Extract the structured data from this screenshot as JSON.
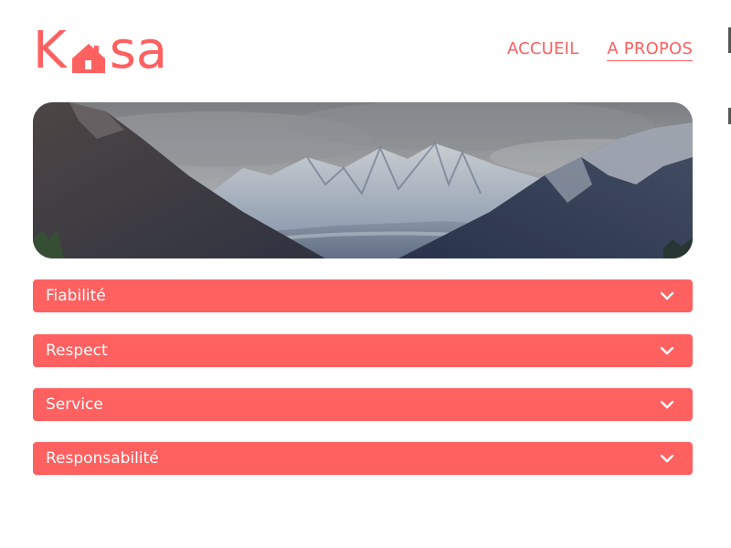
{
  "logo": {
    "prefix": "K",
    "suffix": "sa",
    "brand_color": "#FF6060"
  },
  "nav": {
    "items": [
      {
        "label": "ACCUEIL",
        "active": false
      },
      {
        "label": "A PROPOS",
        "active": true
      }
    ]
  },
  "banner": {
    "subject": "mountain-landscape"
  },
  "collapses": [
    {
      "title": "Fiabilité",
      "icon": "chevron-down-icon"
    },
    {
      "title": "Respect",
      "icon": "chevron-down-icon"
    },
    {
      "title": "Service",
      "icon": "chevron-down-icon"
    },
    {
      "title": "Responsabilité",
      "icon": "chevron-down-icon"
    }
  ]
}
